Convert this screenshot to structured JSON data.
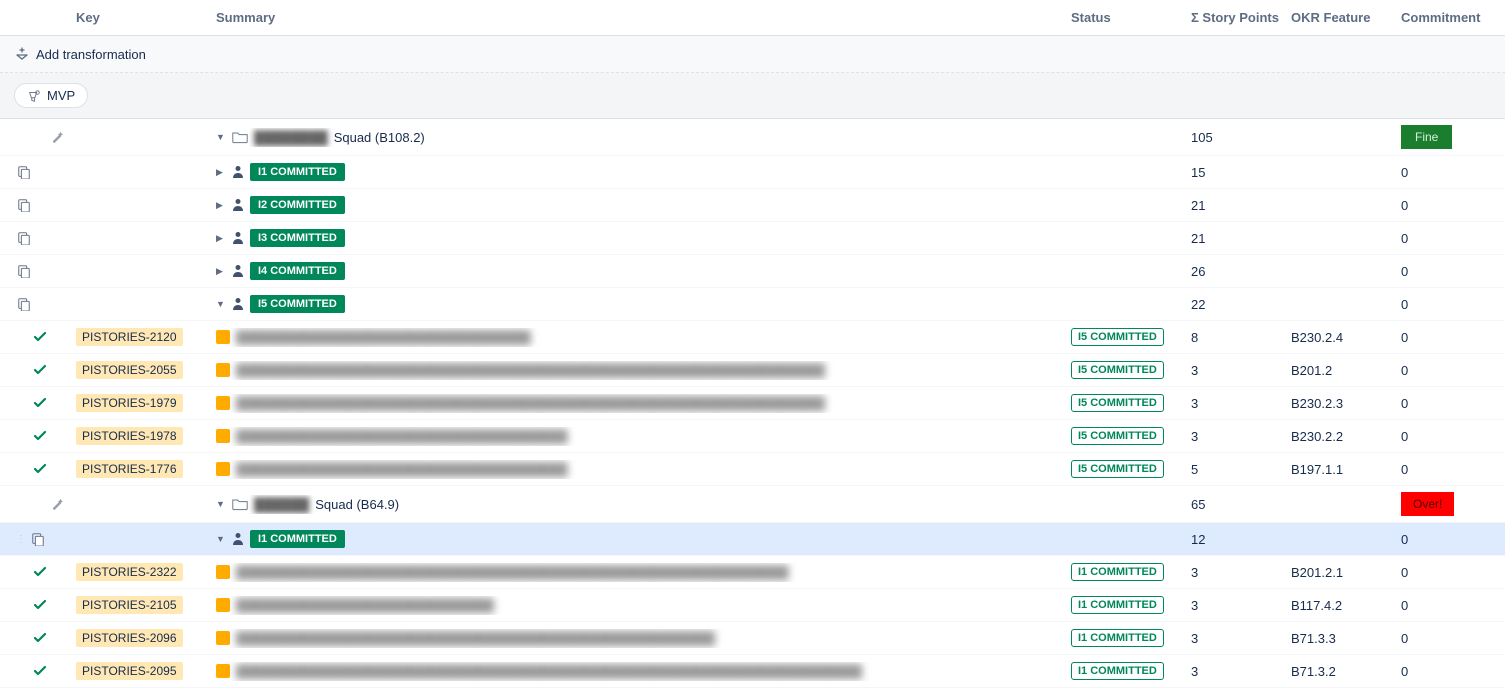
{
  "columns": {
    "key": "Key",
    "summary": "Summary",
    "status": "Status",
    "story_points": "Σ Story Points",
    "okr_feature": "OKR Feature",
    "commitment": "Commitment"
  },
  "toolbar": {
    "add_transformation": "Add transformation"
  },
  "filter": {
    "chip_label": "MVP"
  },
  "badges": {
    "fine": "Fine",
    "over": "Over!"
  },
  "groups": [
    {
      "name_prefix": "████████",
      "name_suffix": "Squad (B108.2)",
      "points": "105",
      "commitment_badge": "fine",
      "iterations": [
        {
          "label": "I1 COMMITTED",
          "points": "15",
          "commitment": "0",
          "expanded": false
        },
        {
          "label": "I2 COMMITTED",
          "points": "21",
          "commitment": "0",
          "expanded": false
        },
        {
          "label": "I3 COMMITTED",
          "points": "21",
          "commitment": "0",
          "expanded": false
        },
        {
          "label": "I4 COMMITTED",
          "points": "26",
          "commitment": "0",
          "expanded": false
        },
        {
          "label": "I5 COMMITTED",
          "points": "22",
          "commitment": "0",
          "expanded": true,
          "stories": [
            {
              "key": "PISTORIES-2120",
              "summary": "████████████████████████████████",
              "status": "I5 COMMITTED",
              "points": "8",
              "okr": "B230.2.4",
              "commitment": "0"
            },
            {
              "key": "PISTORIES-2055",
              "summary": "████████████████████████████████████████████████████████████████",
              "status": "I5 COMMITTED",
              "points": "3",
              "okr": "B201.2",
              "commitment": "0"
            },
            {
              "key": "PISTORIES-1979",
              "summary": "████████████████████████████████████████████████████████████████",
              "status": "I5 COMMITTED",
              "points": "3",
              "okr": "B230.2.3",
              "commitment": "0"
            },
            {
              "key": "PISTORIES-1978",
              "summary": "████████████████████████████████████",
              "status": "I5 COMMITTED",
              "points": "3",
              "okr": "B230.2.2",
              "commitment": "0"
            },
            {
              "key": "PISTORIES-1776",
              "summary": "████████████████████████████████████",
              "status": "I5 COMMITTED",
              "points": "5",
              "okr": "B197.1.1",
              "commitment": "0"
            }
          ]
        }
      ]
    },
    {
      "name_prefix": "██████",
      "name_suffix": "Squad (B64.9)",
      "points": "65",
      "commitment_badge": "over",
      "iterations": [
        {
          "label": "I1 COMMITTED",
          "points": "12",
          "commitment": "0",
          "expanded": true,
          "highlighted": true,
          "stories": [
            {
              "key": "PISTORIES-2322",
              "summary": "████████████████████████████████████████████████████████████",
              "status": "I1 COMMITTED",
              "points": "3",
              "okr": "B201.2.1",
              "commitment": "0"
            },
            {
              "key": "PISTORIES-2105",
              "summary": "████████████████████████████",
              "status": "I1 COMMITTED",
              "points": "3",
              "okr": "B117.4.2",
              "commitment": "0"
            },
            {
              "key": "PISTORIES-2096",
              "summary": "████████████████████████████████████████████████████",
              "status": "I1 COMMITTED",
              "points": "3",
              "okr": "B71.3.3",
              "commitment": "0"
            },
            {
              "key": "PISTORIES-2095",
              "summary": "████████████████████████████████████████████████████████████████████",
              "status": "I1 COMMITTED",
              "points": "3",
              "okr": "B71.3.2",
              "commitment": "0"
            }
          ]
        }
      ]
    }
  ]
}
